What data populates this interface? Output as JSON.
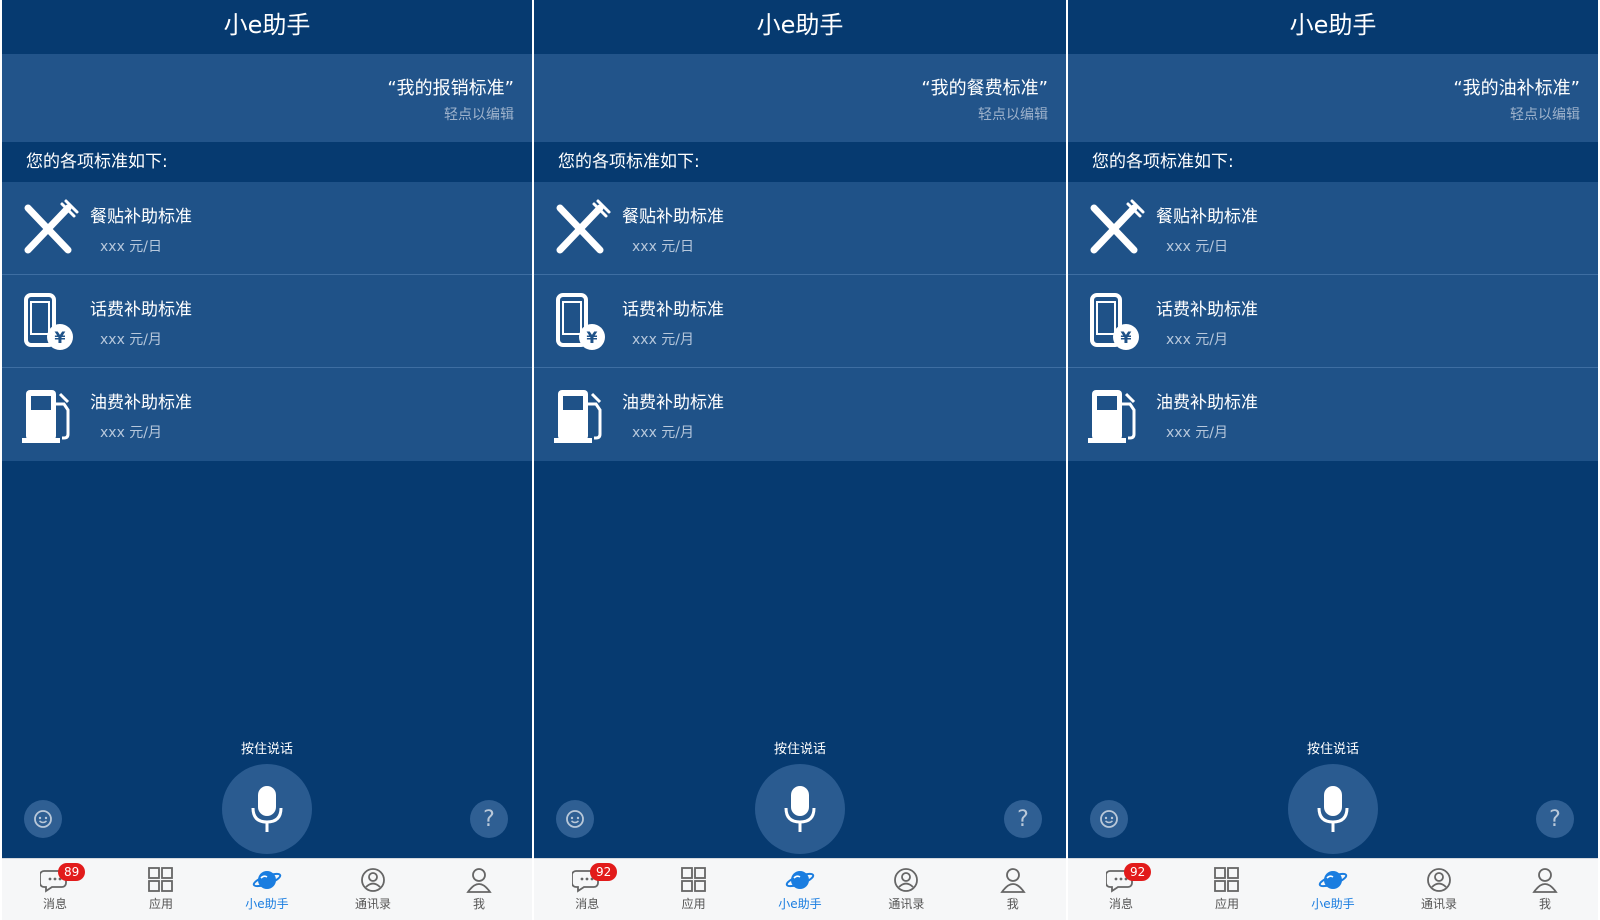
{
  "screens": [
    {
      "title": "小e助手",
      "query": "“我的报销标准”",
      "hint": "轻点以编辑",
      "section": "您的各项标准如下:",
      "items": [
        {
          "name": "餐贴补助标准",
          "value": "xxx 元/日",
          "icon": "cutlery-icon"
        },
        {
          "name": "话费补助标准",
          "value": "xxx 元/月",
          "icon": "phone-yen-icon"
        },
        {
          "name": "油费补助标准",
          "value": "xxx 元/月",
          "icon": "fuel-pump-icon"
        }
      ],
      "push_to_talk": "按住说话",
      "help_symbol": "?",
      "tabs": [
        {
          "label": "消息",
          "badge": "89"
        },
        {
          "label": "应用"
        },
        {
          "label": "小e助手"
        },
        {
          "label": "通讯录"
        },
        {
          "label": "我"
        }
      ]
    },
    {
      "title": "小e助手",
      "query": "“我的餐费标准”",
      "hint": "轻点以编辑",
      "section": "您的各项标准如下:",
      "items": [
        {
          "name": "餐贴补助标准",
          "value": "xxx 元/日",
          "icon": "cutlery-icon"
        },
        {
          "name": "话费补助标准",
          "value": "xxx 元/月",
          "icon": "phone-yen-icon"
        },
        {
          "name": "油费补助标准",
          "value": "xxx 元/月",
          "icon": "fuel-pump-icon"
        }
      ],
      "push_to_talk": "按住说话",
      "help_symbol": "?",
      "tabs": [
        {
          "label": "消息",
          "badge": "92"
        },
        {
          "label": "应用"
        },
        {
          "label": "小e助手"
        },
        {
          "label": "通讯录"
        },
        {
          "label": "我"
        }
      ]
    },
    {
      "title": "小e助手",
      "query": "“我的油补标准”",
      "hint": "轻点以编辑",
      "section": "您的各项标准如下:",
      "items": [
        {
          "name": "餐贴补助标准",
          "value": "xxx 元/日",
          "icon": "cutlery-icon"
        },
        {
          "name": "话费补助标准",
          "value": "xxx 元/月",
          "icon": "phone-yen-icon"
        },
        {
          "name": "油费补助标准",
          "value": "xxx 元/月",
          "icon": "fuel-pump-icon"
        }
      ],
      "push_to_talk": "按住说话",
      "help_symbol": "?",
      "tabs": [
        {
          "label": "消息",
          "badge": "92"
        },
        {
          "label": "应用"
        },
        {
          "label": "小e助手"
        },
        {
          "label": "通讯录"
        },
        {
          "label": "我"
        }
      ]
    }
  ],
  "active_tab": "小e助手",
  "colors": {
    "background": "#063a70",
    "panel": "#1f5288",
    "accent": "#1a7de0",
    "badge": "#e21b1b"
  }
}
